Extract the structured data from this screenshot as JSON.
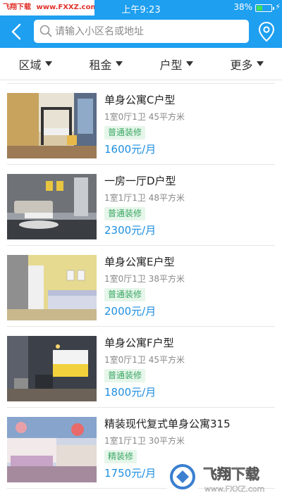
{
  "status": {
    "watermark_left": "飞翔下载",
    "watermark_right": "www.FXXZ.com",
    "time": "上午9:23",
    "battery": "38%",
    "battery_level": 0.38
  },
  "header": {
    "search_placeholder": "请输入小区名或地址"
  },
  "filters": [
    "区域",
    "租金",
    "户型",
    "更多"
  ],
  "listings": [
    {
      "title": "单身公寓C户型",
      "meta": "1室0厅1卫 45平方米",
      "tag": "普通装修",
      "price": "1600元/月"
    },
    {
      "title": "一房一厅D户型",
      "meta": "1室1厅1卫 48平方米",
      "tag": "普通装修",
      "price": "2300元/月"
    },
    {
      "title": "单身公寓E户型",
      "meta": "1室0厅1卫 38平方米",
      "tag": "普通装修",
      "price": "2000元/月"
    },
    {
      "title": "单身公寓F户型",
      "meta": "1室0厅1卫 45平方米",
      "tag": "普通装修",
      "price": "1800元/月"
    },
    {
      "title": "精装现代复式单身公寓315",
      "meta": "1室1厅1卫 30平方米",
      "tag": "精装修",
      "price": "1750元/月"
    }
  ],
  "watermark": {
    "brand": "飞翔下载",
    "url": "www.FXXZ.com"
  },
  "colors": {
    "primary": "#1e9ff0",
    "price": "#1f8fe0",
    "tag_text": "#3ca765",
    "tag_bg": "#e6f6ea"
  }
}
